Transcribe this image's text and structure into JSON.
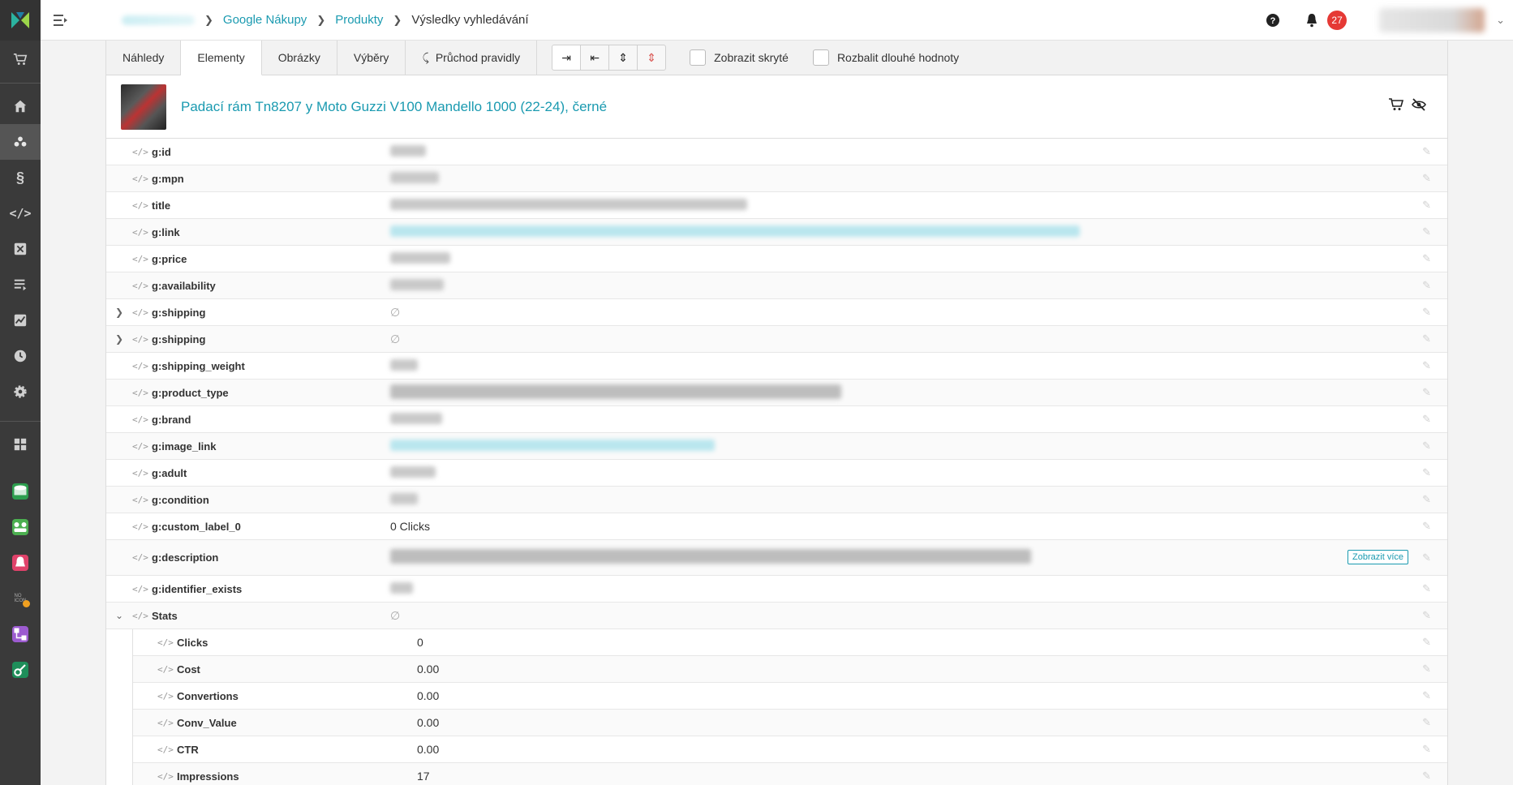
{
  "nav": {
    "items": [
      "cart-icon",
      "home-icon",
      "groups-icon",
      "paragraph-icon",
      "code-icon",
      "function-icon",
      "list-icon",
      "chart-icon",
      "clock-icon",
      "gear-icon",
      "grid-icon"
    ],
    "apps": [
      {
        "name": "db-app-icon",
        "color": "#2e9e4f"
      },
      {
        "name": "people-app-icon",
        "color": "#4caf50"
      },
      {
        "name": "bell-app-icon",
        "color": "#e0426a"
      },
      {
        "name": "no-icon-app",
        "color": "#555555",
        "badge": "#f0a020"
      },
      {
        "name": "flow-app-icon",
        "color": "#9c5bd0"
      },
      {
        "name": "key-app-icon",
        "color": "#1e8e5a"
      }
    ]
  },
  "topbar": {
    "breadcrumb": {
      "level1": "Google Nákupy",
      "level2": "Produkty",
      "current": "Výsledky vyhledávání"
    },
    "notifications_count": "27"
  },
  "tabs": {
    "items": [
      "Náhledy",
      "Elementy",
      "Obrázky",
      "Výběry",
      "Průchod pravidly"
    ],
    "active": "Elementy"
  },
  "toolbar": {
    "show_hidden_label": "Zobrazit skryté",
    "expand_long_label": "Rozbalit dlouhé hodnoty"
  },
  "product": {
    "title": "Padací rám Tn8207 y Moto Guzzi V100 Mandello 1000 (22-24), černé"
  },
  "attributes": [
    {
      "name": "g:id",
      "value": ""
    },
    {
      "name": "g:mpn",
      "value": ""
    },
    {
      "name": "title",
      "value": ""
    },
    {
      "name": "g:link",
      "value": ""
    },
    {
      "name": "g:price",
      "value": ""
    },
    {
      "name": "g:availability",
      "value": ""
    },
    {
      "name": "g:shipping",
      "value": ""
    },
    {
      "name": "g:shipping",
      "value": ""
    },
    {
      "name": "g:shipping_weight",
      "value": ""
    },
    {
      "name": "g:product_type",
      "value": ""
    },
    {
      "name": "g:brand",
      "value": ""
    },
    {
      "name": "g:image_link",
      "value": ""
    },
    {
      "name": "g:adult",
      "value": ""
    },
    {
      "name": "g:condition",
      "value": ""
    },
    {
      "name": "g:custom_label_0",
      "value": "0 Clicks"
    },
    {
      "name": "g:description",
      "value": "",
      "action": "Zobrazit více"
    },
    {
      "name": "g:identifier_exists",
      "value": ""
    },
    {
      "name": "Stats",
      "value": ""
    }
  ],
  "stats": [
    {
      "name": "Clicks",
      "value": "0"
    },
    {
      "name": "Cost",
      "value": "0.00"
    },
    {
      "name": "Convertions",
      "value": "0.00"
    },
    {
      "name": "Conv_Value",
      "value": "0.00"
    },
    {
      "name": "CTR",
      "value": "0.00"
    },
    {
      "name": "Impressions",
      "value": "17"
    }
  ]
}
